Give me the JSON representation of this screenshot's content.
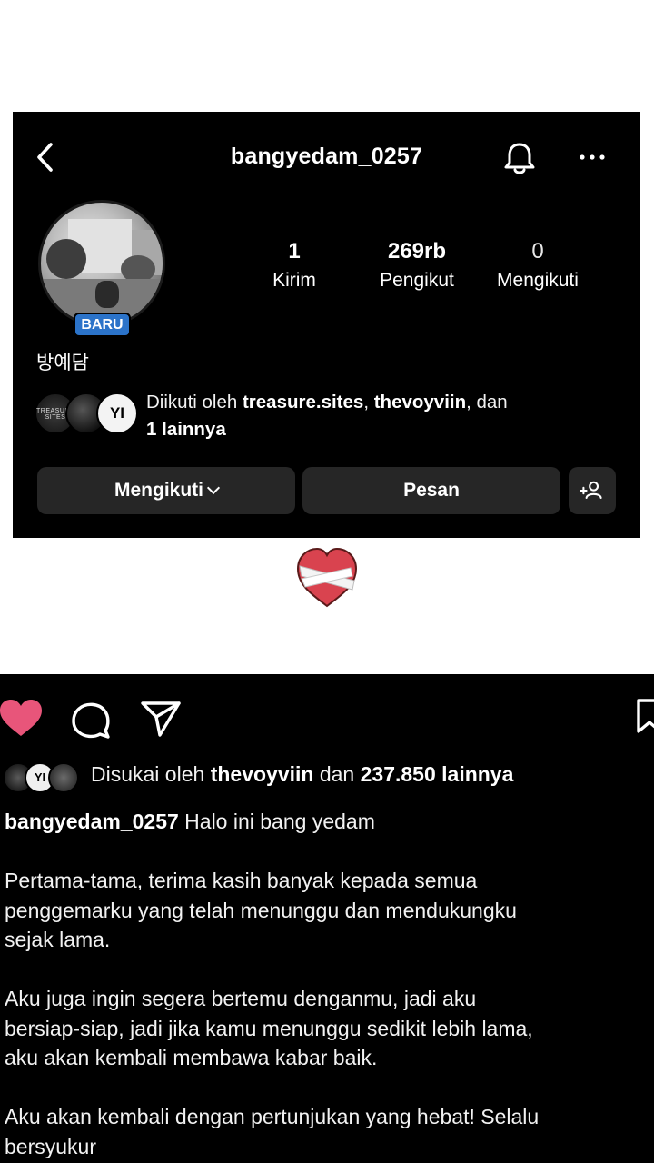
{
  "profile": {
    "username": "bangyedam_0257",
    "badge": "BARU",
    "display_name": "방예담",
    "stats": {
      "posts": {
        "value": "1",
        "label": "Kirim"
      },
      "followers": {
        "value": "269rb",
        "label": "Pengikut"
      },
      "following": {
        "value": "0",
        "label": "Mengikuti"
      }
    },
    "followed_by": {
      "prefix": "Diikuti oleh ",
      "user1": "treasure.sites",
      "sep": ", ",
      "user2": "thevoyviin",
      "suffix": ", dan",
      "more": "1 lainnya",
      "avatar1_text": "TREASURE SITES",
      "avatar3_text": "YI"
    },
    "buttons": {
      "following": "Mengikuti",
      "message": "Pesan"
    }
  },
  "post": {
    "likes": {
      "prefix": "Disukai oleh ",
      "user": "thevoyviin",
      "middle": " dan ",
      "count": "237.850 lainnya",
      "avatar2_text": "YI"
    },
    "caption": {
      "username": "bangyedam_0257",
      "first_line": " Halo ini bang yedam",
      "paragraph1": "Pertama-tama, terima kasih banyak kepada semua\npenggemarku yang telah menunggu dan mendukungku\nsejak lama.",
      "paragraph2": "Aku juga ingin segera bertemu denganmu, jadi aku\nbersiap-siap, jadi jika kamu menunggu sedikit lebih lama,\naku akan kembali membawa kabar baik.",
      "paragraph3": "Aku akan kembali dengan pertunjukan yang hebat! Selalu\nbersyukur"
    }
  },
  "colors": {
    "badge_blue": "#2b73c9",
    "button_gray": "#262626",
    "like_pink": "#e8557a",
    "heart_red": "#d9434f"
  },
  "icons": [
    "back-icon",
    "bell-icon",
    "more-icon",
    "add-person-icon",
    "chevron-down-icon",
    "heart-icon",
    "comment-icon",
    "share-icon",
    "bookmark-icon",
    "mending-heart-icon"
  ]
}
